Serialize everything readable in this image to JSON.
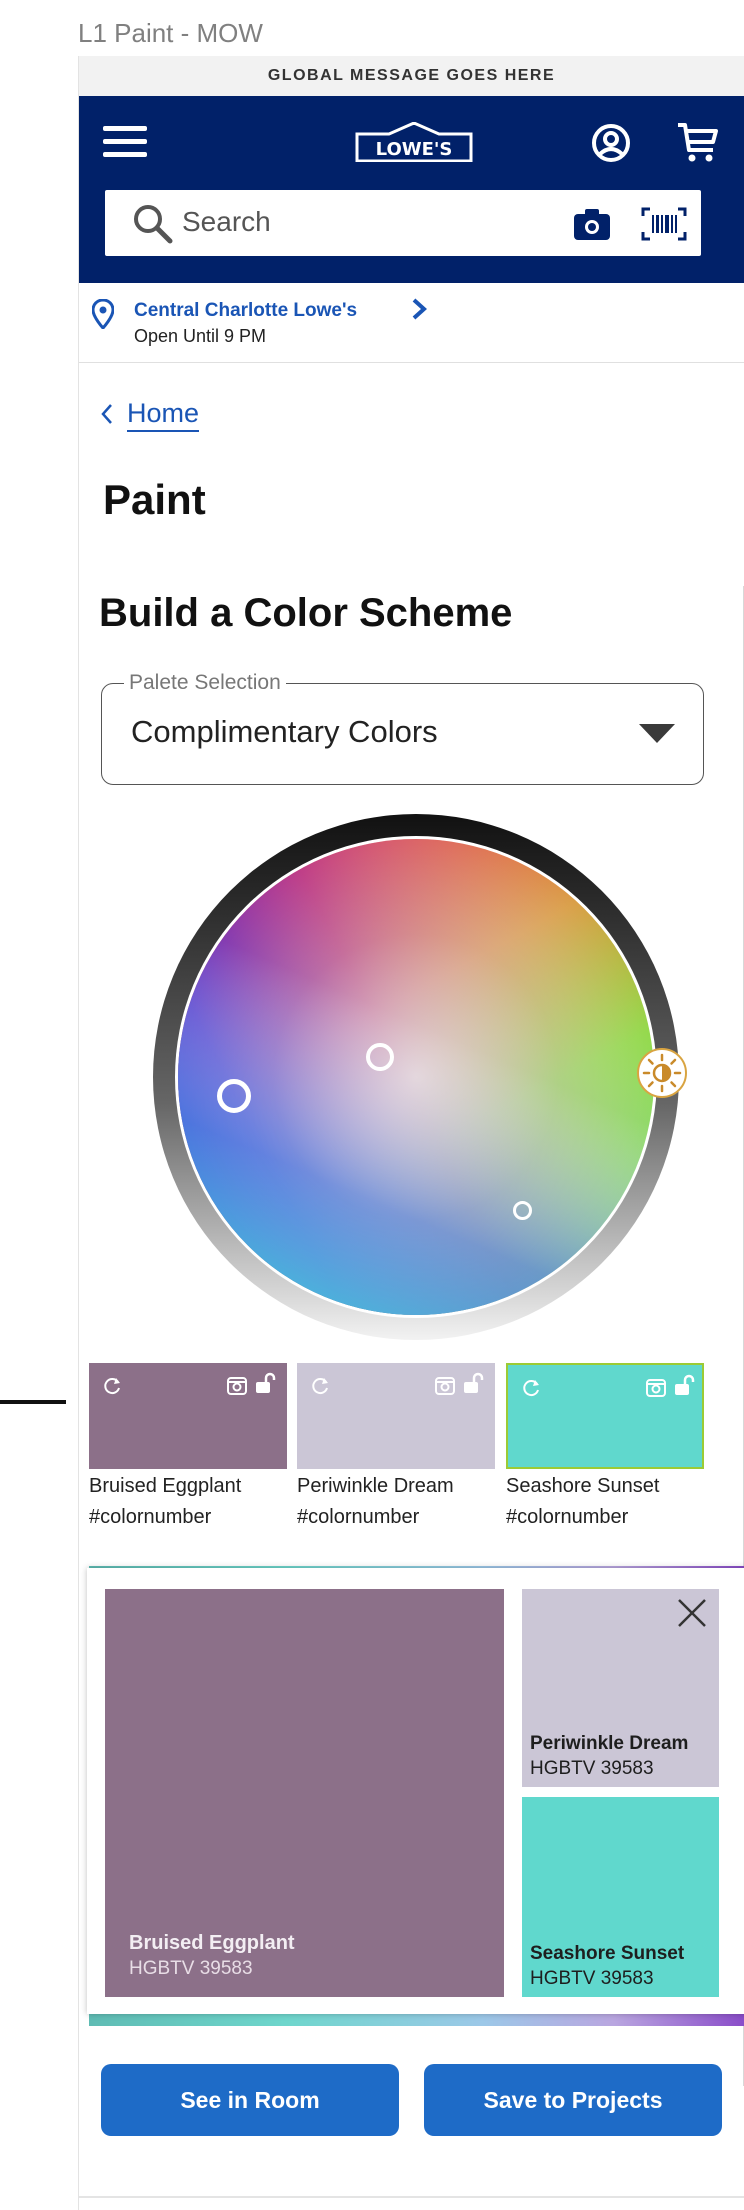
{
  "frame_label": "L1 Paint - MOW",
  "global_message": "GLOBAL MESSAGE GOES HERE",
  "header": {
    "logo_text": "LOWE'S",
    "search_placeholder": "Search",
    "bg_color": "#012169"
  },
  "store": {
    "name": "Central Charlotte Lowe's",
    "hours": "Open Until 9 PM"
  },
  "breadcrumb": {
    "home": "Home"
  },
  "page_title": "Paint",
  "section_title": "Build a Color Scheme",
  "palette_select": {
    "label": "Palete Selection",
    "value": "Complimentary Colors"
  },
  "swatches": [
    {
      "name": "Bruised Eggplant",
      "number": "#colornumber",
      "color": "#8c7089"
    },
    {
      "name": "Periwinkle Dream",
      "number": "#colornumber",
      "color": "#cbc6d6"
    },
    {
      "name": "Seashore Sunset",
      "number": "#colornumber",
      "color": "#60d8cd"
    }
  ],
  "preview": {
    "main": {
      "name": "Bruised Eggplant",
      "code": "HGBTV 39583"
    },
    "side": [
      {
        "name": "Periwinkle Dream",
        "code": "HGBTV 39583"
      },
      {
        "name": "Seashore Sunset",
        "code": "HGBTV 39583"
      }
    ]
  },
  "actions": {
    "see_in_room": "See in Room",
    "save_to_projects": "Save to Projects"
  },
  "colors": {
    "accent_blue": "#1e6bc7",
    "link_blue": "#1a55b5"
  }
}
